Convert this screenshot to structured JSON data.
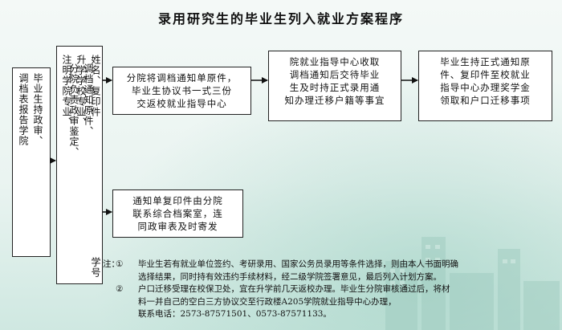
{
  "title": "录用研究生的毕业生列入就业方案程序",
  "step1": {
    "col1": "毕业生持政审、",
    "col2": "调档表报告学院"
  },
  "step2": {
    "cols": [
      "注明学院专业、",
      "分院负责政审鉴定、",
      "升学学校专业、",
      "调档通知原件、",
      "姓名、复印件",
      "学号"
    ]
  },
  "step3": {
    "lines": [
      "分院将调档通知单原件，",
      "毕业生协议书一式三份",
      "交返校就业指导中心"
    ]
  },
  "step4": {
    "lines": [
      "院就业指导中心收取",
      "调档通知后交待毕业",
      "生及时持正式录用通",
      "知办理迁移户籍等事宜"
    ]
  },
  "step5": {
    "lines": [
      "毕业生持正式通知原",
      "件、复印件至校就业",
      "指导中心办理奖学金",
      "领取和户口迁移事项"
    ]
  },
  "step6": {
    "lines": [
      "通知单复印件由分院",
      "联系综合档案室，连",
      "同政审表及时寄发"
    ]
  },
  "notes": {
    "prefix": "注：",
    "n1_tag": "①",
    "n1_lines": [
      "毕业生若有就业单位签约、考研录用、国家公务员录用等条件选择，则由本人书面明确",
      "选择结果，同时持有效违约手续材料，经二级学院签署意见，最后列入计划方案。"
    ],
    "n2_tag": "②",
    "n2_lines": [
      "户口迁移受理在校保卫处，宜在升学前几天返校办理。毕业生分院审核通过后，将材",
      "料一并自己的空白三方协议交至行政楼A205学院就业指导中心办理，",
      "联系电话：2573-87571501、0573-87571133。"
    ]
  }
}
